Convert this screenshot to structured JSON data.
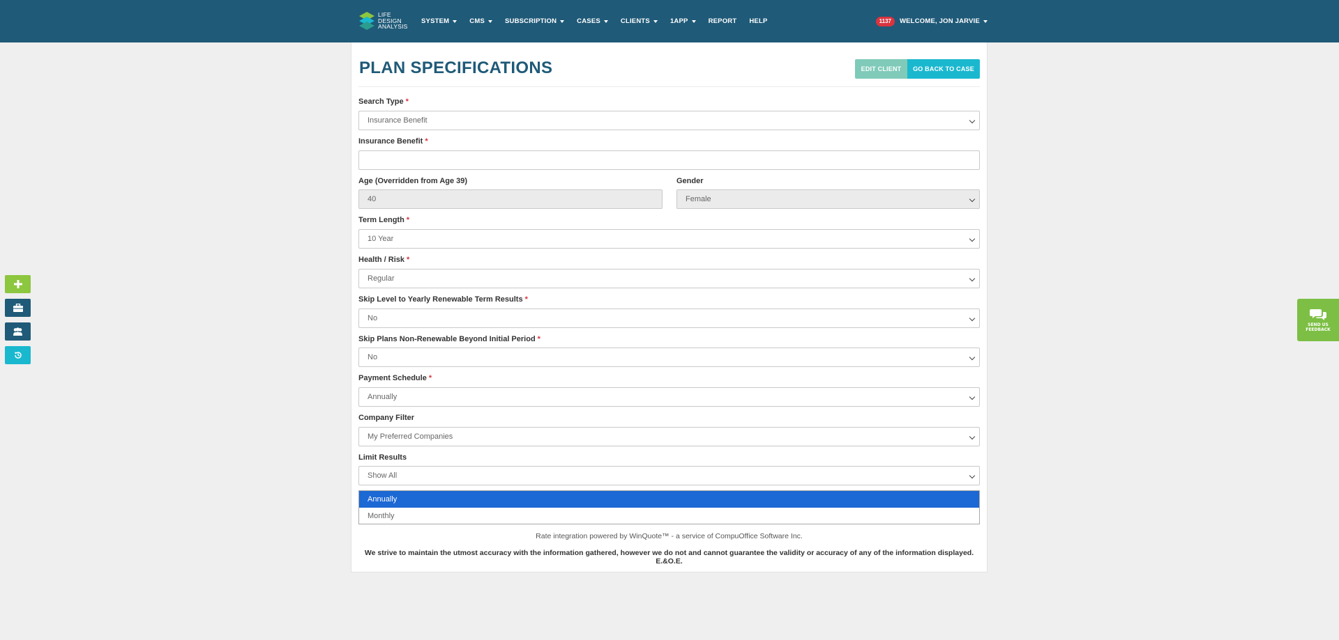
{
  "brand": {
    "logo_lines": [
      "LIFE",
      "DESIGN",
      "ANALYSIS"
    ]
  },
  "nav": {
    "items": [
      {
        "label": "SYSTEM",
        "dropdown": true
      },
      {
        "label": "CMS",
        "dropdown": true
      },
      {
        "label": "SUBSCRIPTION",
        "dropdown": true
      },
      {
        "label": "CASES",
        "dropdown": true
      },
      {
        "label": "CLIENTS",
        "dropdown": true
      },
      {
        "label": "1APP",
        "dropdown": true
      },
      {
        "label": "REPORT",
        "dropdown": false
      },
      {
        "label": "HELP",
        "dropdown": false
      }
    ],
    "notification_count": "1137",
    "welcome": "WELCOME, JON JARVIE"
  },
  "page": {
    "title": "PLAN SPECIFICATIONS",
    "edit_client": "EDIT CLIENT",
    "go_back": "GO BACK TO CASE"
  },
  "form": {
    "search_type": {
      "label": "Search Type",
      "required": "*",
      "value": "Insurance Benefit"
    },
    "insurance_benefit": {
      "label": "Insurance Benefit",
      "required": "*",
      "value": ""
    },
    "age": {
      "label": "Age (Overridden from Age 39)",
      "value": "40"
    },
    "gender": {
      "label": "Gender",
      "value": "Female"
    },
    "term_length": {
      "label": "Term Length",
      "required": "*",
      "value": "10 Year"
    },
    "health_risk": {
      "label": "Health / Risk",
      "required": "*",
      "value": "Regular"
    },
    "skip_level": {
      "label": "Skip Level to Yearly Renewable Term Results",
      "required": "*",
      "value": "No"
    },
    "skip_plans": {
      "label": "Skip Plans Non-Renewable Beyond Initial Period",
      "required": "*",
      "value": "No"
    },
    "payment_schedule": {
      "label": "Payment Schedule",
      "required": "*",
      "value": "Annually"
    },
    "company_filter": {
      "label": "Company Filter",
      "value": "My Preferred Companies"
    },
    "limit_results": {
      "label": "Limit Results",
      "value": "Show All"
    }
  },
  "dropdown": {
    "options": [
      "Annually",
      "Monthly"
    ],
    "selected": "Annually"
  },
  "footer": {
    "powered_by": "Rate integration powered by WinQuote™ - a service of CompuOffice Software Inc.",
    "disclaimer": "We strive to maintain the utmost accuracy with the information gathered, however we do not and cannot guarantee the validity or accuracy of any of the information displayed. E.&O.E."
  },
  "side_buttons": [
    {
      "icon": "plus-icon",
      "color": "#8dc63f"
    },
    {
      "icon": "briefcase-icon",
      "color": "#1f5a78"
    },
    {
      "icon": "users-icon",
      "color": "#1f5a78"
    },
    {
      "icon": "history-icon",
      "color": "#1ab8cf"
    }
  ],
  "feedback": {
    "lines": [
      "SEND US",
      "FEEDBACK"
    ],
    "color": "#7cbf44"
  },
  "colors": {
    "navbar": "#1f5a78",
    "accent": "#1ab8cf",
    "required": "#d9343f",
    "selection": "#1c68d4"
  }
}
